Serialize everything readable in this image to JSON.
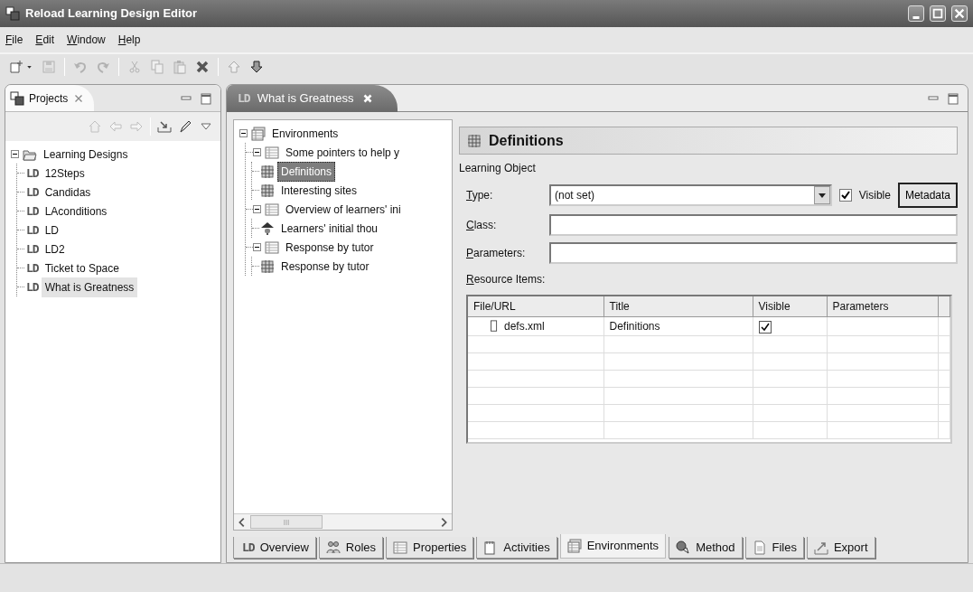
{
  "window": {
    "title": "Reload Learning Design Editor"
  },
  "menu": [
    "File",
    "Edit",
    "Window",
    "Help"
  ],
  "toolbar": [
    {
      "kind": "new",
      "disabled": false
    },
    {
      "kind": "dropdown",
      "disabled": false
    },
    {
      "kind": "save",
      "disabled": true
    },
    {
      "kind": "separator"
    },
    {
      "kind": "undo",
      "disabled": true
    },
    {
      "kind": "redo",
      "disabled": true
    },
    {
      "kind": "separator"
    },
    {
      "kind": "cut",
      "disabled": true
    },
    {
      "kind": "copy",
      "disabled": true
    },
    {
      "kind": "paste",
      "disabled": true
    },
    {
      "kind": "delete",
      "disabled": false
    },
    {
      "kind": "separator"
    },
    {
      "kind": "up",
      "disabled": true
    },
    {
      "kind": "down",
      "disabled": false
    }
  ],
  "projects_view": {
    "title": "Projects",
    "toolbar": [
      {
        "kind": "home",
        "disabled": true
      },
      {
        "kind": "back",
        "disabled": true
      },
      {
        "kind": "forward",
        "disabled": true
      },
      {
        "kind": "separator"
      },
      {
        "kind": "import",
        "disabled": false
      },
      {
        "kind": "pen",
        "disabled": false
      },
      {
        "kind": "viewmenu",
        "disabled": false
      }
    ],
    "tree": [
      {
        "label": "Learning Designs",
        "kind": "folder",
        "expanded": true,
        "selected": false,
        "children": [
          {
            "label": "12Steps",
            "kind": "ld",
            "icon_text": "LD",
            "selected": false
          },
          {
            "label": "Candidas",
            "kind": "ld",
            "icon_text": "LD",
            "selected": false
          },
          {
            "label": "LAconditions",
            "kind": "ld",
            "icon_text": "LD",
            "selected": false
          },
          {
            "label": "LD",
            "kind": "ld",
            "icon_text": "LD",
            "selected": false
          },
          {
            "label": "LD2",
            "kind": "ld",
            "icon_text": "LD",
            "selected": false
          },
          {
            "label": "Ticket to Space",
            "kind": "ld",
            "icon_text": "LD",
            "selected": false
          },
          {
            "label": "What is Greatness",
            "kind": "ld",
            "icon_text": "LD",
            "selected": true
          }
        ]
      }
    ]
  },
  "editor": {
    "tab": {
      "icon_text": "LD",
      "title": "What is Greatness"
    },
    "tree": [
      {
        "label": "Environments",
        "kind": "environment",
        "expanded": true,
        "selected": false,
        "children": [
          {
            "label": "Some pointers to help y",
            "kind": "table",
            "expanded": true,
            "selected": false,
            "children": [
              {
                "label": "Definitions",
                "kind": "grid",
                "selected": true
              },
              {
                "label": "Interesting sites",
                "kind": "grid",
                "selected": false
              }
            ]
          },
          {
            "label": "Overview of learners' ini",
            "kind": "table",
            "expanded": true,
            "selected": false,
            "children": [
              {
                "label": "Learners' initial thou",
                "kind": "learner",
                "selected": false
              }
            ]
          },
          {
            "label": "Response by tutor",
            "kind": "table",
            "expanded": true,
            "selected": false,
            "children": [
              {
                "label": "Response by tutor",
                "kind": "grid",
                "selected": false
              }
            ]
          }
        ]
      }
    ],
    "details": {
      "heading": "Definitions",
      "subtitle": "Learning Object",
      "type": {
        "label": "Type:",
        "value": "(not set)"
      },
      "visible": {
        "label": "Visible",
        "checked": true
      },
      "metadata_button": "Metadata",
      "class_field": {
        "label": "Class:"
      },
      "parameters_field": {
        "label": "Parameters:"
      },
      "resources": {
        "label": "Resource Items:",
        "columns": [
          "File/URL",
          "Title",
          "Visible",
          "Parameters"
        ],
        "rows": [
          {
            "file": "defs.xml",
            "title": "Definitions",
            "visible": true
          }
        ]
      }
    },
    "bottom_tabs": [
      {
        "label": "Overview",
        "kind": "ld",
        "icon_text": "LD",
        "selected": false
      },
      {
        "label": "Roles",
        "kind": "roles",
        "selected": false
      },
      {
        "label": "Properties",
        "kind": "table",
        "selected": false
      },
      {
        "label": "Activities",
        "kind": "activities",
        "selected": false
      },
      {
        "label": "Environments",
        "kind": "environment",
        "selected": true
      },
      {
        "label": "Method",
        "kind": "method",
        "selected": false
      },
      {
        "label": "Files",
        "kind": "file",
        "selected": false
      },
      {
        "label": "Export",
        "kind": "export",
        "selected": false
      }
    ]
  }
}
